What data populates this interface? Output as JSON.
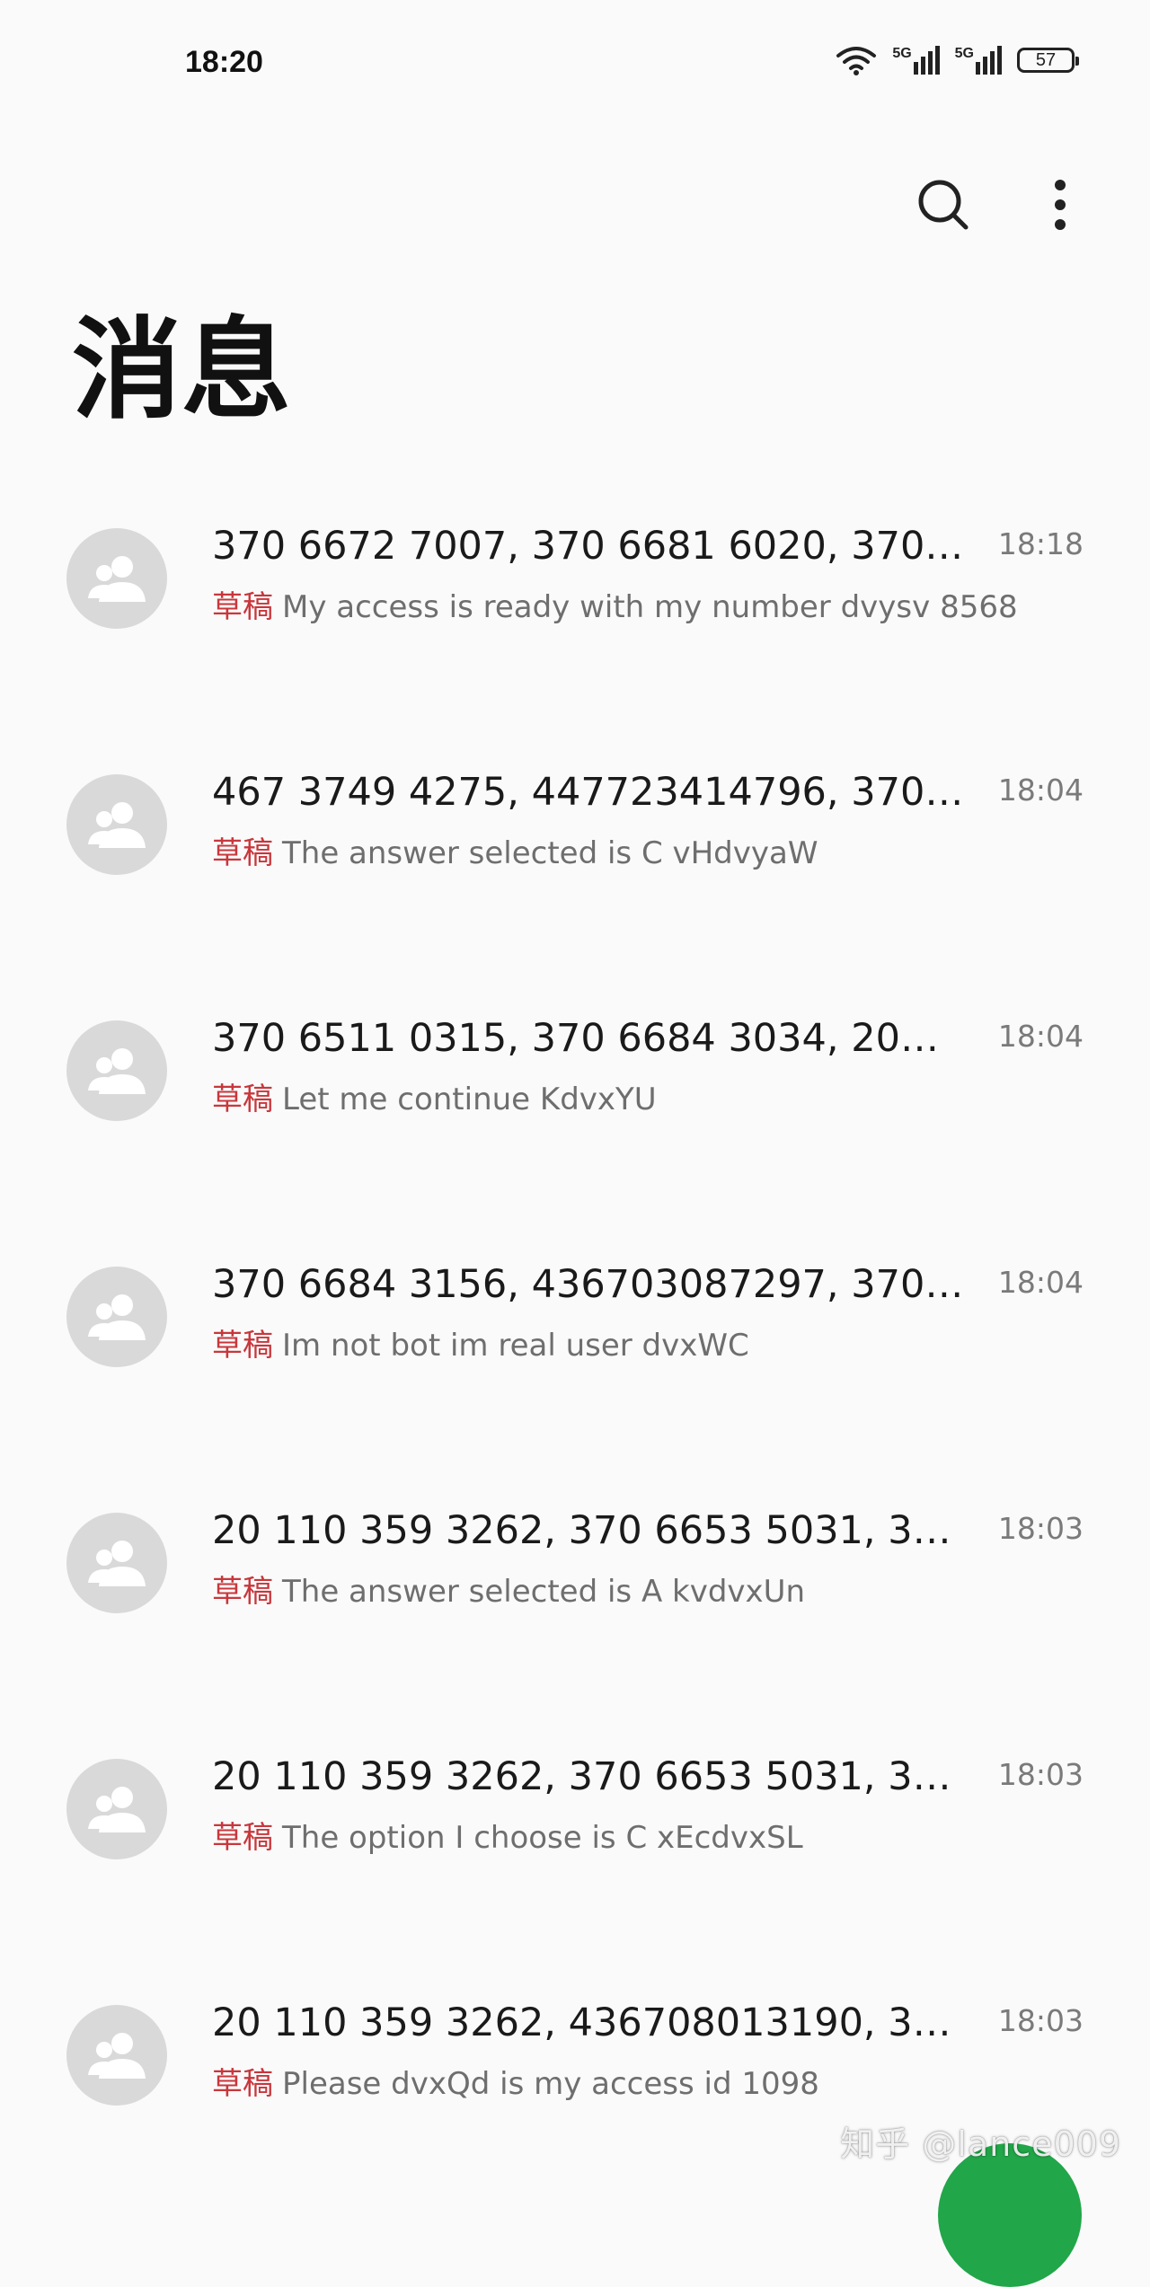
{
  "status_bar": {
    "time": "18:20",
    "battery": "57",
    "network_labels": [
      "5G",
      "5G"
    ]
  },
  "header": {
    "title": "消息",
    "search_icon": "search-icon",
    "more_icon": "more-vertical-icon"
  },
  "conversations": [
    {
      "title": "370 6672 7007, 370 6681 6020, 370…",
      "time": "18:18",
      "draft_label": "草稿",
      "preview": "My access is ready with my number dvysv 8568"
    },
    {
      "title": "467 3749 4275, 447723414796, 370…",
      "time": "18:04",
      "draft_label": "草稿",
      "preview": "The answer selected is C vHdvyaW"
    },
    {
      "title": "370 6511 0315, 370 6684 3034, 20…",
      "time": "18:04",
      "draft_label": "草稿",
      "preview": "Let me continue KdvxYU"
    },
    {
      "title": "370 6684 3156, 436703087297, 370…",
      "time": "18:04",
      "draft_label": "草稿",
      "preview": "Im not bot im real user dvxWC"
    },
    {
      "title": "20 110 359 3262, 370 6653 5031, 3…",
      "time": "18:03",
      "draft_label": "草稿",
      "preview": "The answer selected is A kvdvxUn"
    },
    {
      "title": "20 110 359 3262, 370 6653 5031, 3…",
      "time": "18:03",
      "draft_label": "草稿",
      "preview": "The option I choose is C xEcdvxSL"
    },
    {
      "title": "20 110 359 3262, 436708013190, 3…",
      "time": "18:03",
      "draft_label": "草稿",
      "preview": "Please dvxQd is my access id 1098"
    }
  ],
  "watermark": "知乎 @lance009",
  "colors": {
    "draft": "#c8373c",
    "avatar_bg": "#d9d9d9",
    "fab": "#21a649",
    "background": "#fafafa"
  }
}
